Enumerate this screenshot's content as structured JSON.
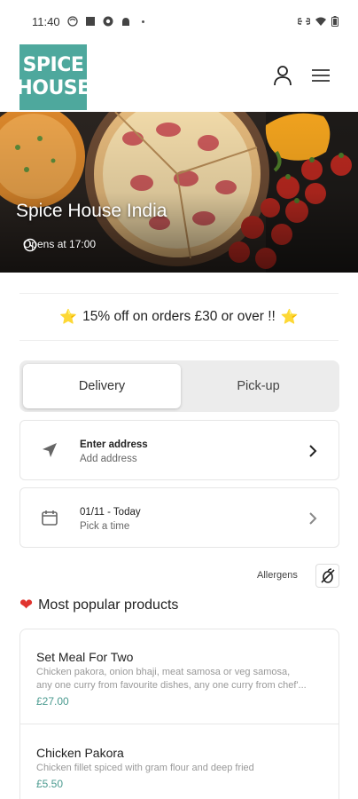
{
  "status_bar": {
    "time": "11:40",
    "icons": [
      "face-icon",
      "stop-icon",
      "chrome-icon",
      "android-icon",
      "dot",
      "link-icon",
      "wifi-icon",
      "battery-icon"
    ]
  },
  "header": {
    "logo_line1": "SPICE",
    "logo_line2": "HOUSE",
    "logo_color": "#4ea89d",
    "icons": [
      "account-icon",
      "menu-icon"
    ]
  },
  "hero": {
    "title": "Spice House India",
    "opens": "Opens at 17:00",
    "icon": "clock-icon"
  },
  "promo": {
    "text": "15% off on orders £30 or over !!",
    "icon": "star-icon",
    "icon_color": "#f3b60f"
  },
  "order_type": {
    "options": [
      "Delivery",
      "Pick-up"
    ],
    "selected": "Delivery"
  },
  "address": {
    "title": "Enter address",
    "subtitle": "Add address",
    "icon": "navigation-icon"
  },
  "time": {
    "title": "01/11 - Today",
    "subtitle": "Pick a time",
    "icon": "calendar-icon"
  },
  "allergens": {
    "label": "Allergens",
    "icon": "allergen-icon"
  },
  "popular": {
    "heading": "Most popular products",
    "icon": "heart-icon",
    "products": [
      {
        "name": "Set Meal For Two",
        "desc_line1": "Chicken pakora, onion bhaji, meat samosa or veg samosa,",
        "desc_line2": "any one curry from favourite dishes, any one curry from chef'...",
        "price": "£27.00"
      },
      {
        "name": "Chicken Pakora",
        "desc_line1": "Chicken fillet spiced with gram flour and deep fried",
        "price": "£5.50"
      }
    ]
  },
  "accent_color": "#4a9a8f"
}
